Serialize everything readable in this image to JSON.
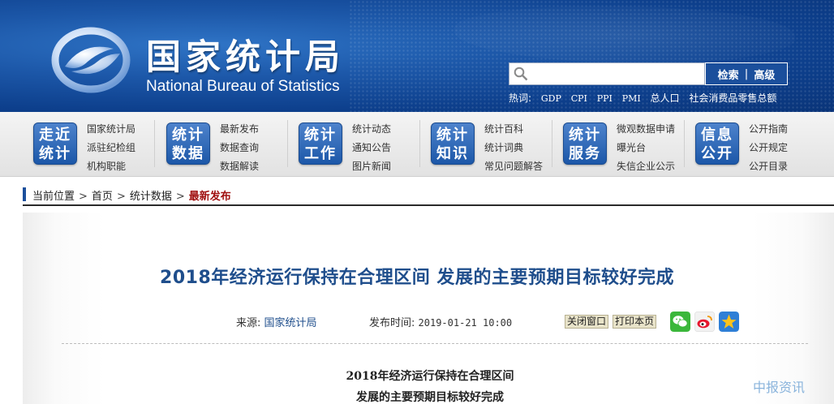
{
  "header": {
    "title_cn": "国家统计局",
    "title_en": "National Bureau of Statistics",
    "search": {
      "placeholder": "",
      "button_search": "检索",
      "separator": "|",
      "button_advanced": "高级"
    },
    "hot": {
      "label": "热词:",
      "keywords": [
        "GDP",
        "CPI",
        "PPI",
        "PMI",
        "总人口",
        "社会消费品零售总额"
      ]
    }
  },
  "nav": [
    {
      "badge": [
        "走近",
        "统计"
      ],
      "links": [
        "国家统计局",
        "派驻纪检组",
        "机构职能"
      ]
    },
    {
      "badge": [
        "统计",
        "数据"
      ],
      "links": [
        "最新发布",
        "数据查询",
        "数据解读"
      ]
    },
    {
      "badge": [
        "统计",
        "工作"
      ],
      "links": [
        "统计动态",
        "通知公告",
        "图片新闻"
      ]
    },
    {
      "badge": [
        "统计",
        "知识"
      ],
      "links": [
        "统计百科",
        "统计词典",
        "常见问题解答"
      ]
    },
    {
      "badge": [
        "统计",
        "服务"
      ],
      "links": [
        "微观数据申请",
        "曝光台",
        "失信企业公示"
      ]
    },
    {
      "badge": [
        "信息",
        "公开"
      ],
      "links": [
        "公开指南",
        "公开规定",
        "公开目录"
      ]
    }
  ],
  "breadcrumb": {
    "label": "当前位置",
    "items": [
      "首页",
      "统计数据",
      "最新发布"
    ],
    "arrow": ">"
  },
  "article": {
    "title": "2018年经济运行保持在合理区间  发展的主要预期目标较好完成",
    "source_label": "来源:",
    "source": "国家统计局",
    "date_label": "发布时间:",
    "date": "2019-01-21 10:00",
    "close_btn": "关闭窗口",
    "print_btn": "打印本页",
    "subtitle_line1": "2018年经济运行保持在合理区间",
    "subtitle_line2": "发展的主要预期目标较好完成"
  },
  "watermark": "中报资讯",
  "colors": {
    "header_blue": "#1c57a8",
    "title_blue": "#1f4e8c",
    "current_red": "#a01010"
  }
}
